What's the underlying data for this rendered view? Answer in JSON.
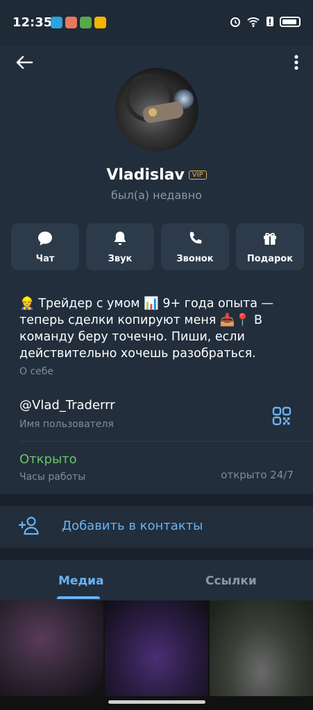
{
  "status_bar": {
    "time": "12:35",
    "app_colors": [
      "#2aa3e0",
      "#e85a5a",
      "#5aa84a",
      "#f3b500"
    ]
  },
  "profile": {
    "name": "Vladislav",
    "badge": "VIP",
    "status": "был(а) недавно"
  },
  "actions": [
    {
      "label": "Чат",
      "icon": "chat-bubble-icon"
    },
    {
      "label": "Звук",
      "icon": "bell-icon"
    },
    {
      "label": "Звонок",
      "icon": "phone-icon"
    },
    {
      "label": "Подарок",
      "icon": "gift-icon"
    }
  ],
  "info": {
    "bio": "👷 Трейдер с умом 📊 9+ года опыта — теперь сделки копируют меня 📥📍 В команду беру точечно. Пиши, если действительно хочешь разобраться.",
    "bio_label": "О себе",
    "username": "@Vlad_Traderrr",
    "username_label": "Имя пользователя",
    "hours_status": "Открыто",
    "hours_label": "Часы работы",
    "hours_value": "открыто 24/7"
  },
  "add_contact": {
    "label": "Добавить в контакты"
  },
  "tabs": {
    "media": "Медиа",
    "links": "Ссылки"
  },
  "colors": {
    "accent": "#6ab3f3",
    "open_green": "#6cc56b",
    "vip_gold": "#e8b04b"
  }
}
